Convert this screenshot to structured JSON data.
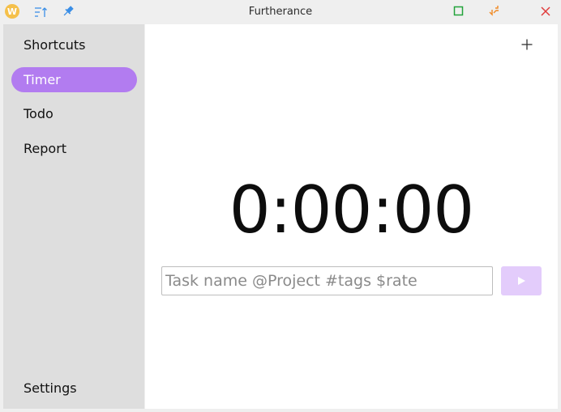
{
  "window": {
    "title": "Furtherance",
    "app_icon_letter": "W"
  },
  "titlebar": {
    "icons": [
      "app-icon",
      "sort-icon",
      "pin-icon",
      "maximize-icon",
      "restore-icon",
      "close-icon"
    ],
    "colors": {
      "app_icon": "#f5c04a",
      "sort": "#3a8ee6",
      "pin": "#3a8ee6",
      "maximize": "#22a33a",
      "restore": "#f08a24",
      "close": "#e03b3b"
    }
  },
  "sidebar": {
    "items": [
      {
        "label": "Shortcuts",
        "active": false
      },
      {
        "label": "Timer",
        "active": true
      },
      {
        "label": "Todo",
        "active": false
      },
      {
        "label": "Report",
        "active": false
      }
    ],
    "settings_label": "Settings"
  },
  "main": {
    "timer": "0:00:00",
    "task_input": {
      "value": "",
      "placeholder": "Task name @Project #tags $rate"
    },
    "start_button_icon": "play-icon",
    "add_button_icon": "plus-icon"
  },
  "colors": {
    "accent": "#b27cf0",
    "accent_light": "#e3ccfb",
    "sidebar_bg": "#dedede",
    "main_bg": "#ffffff"
  }
}
